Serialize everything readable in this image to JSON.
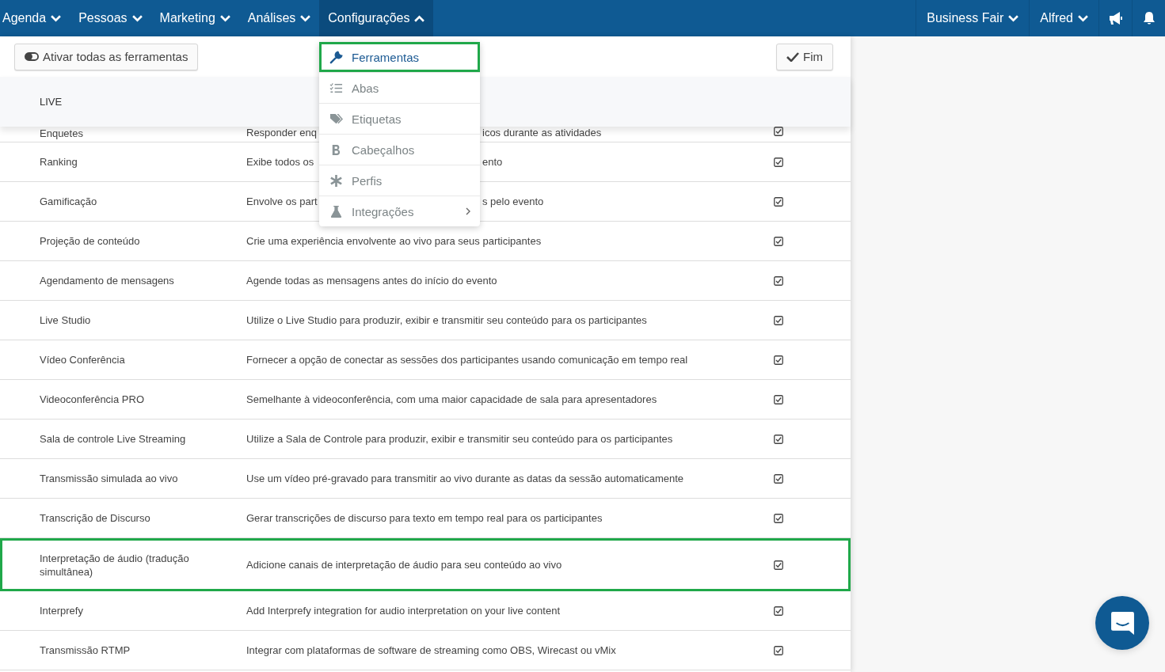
{
  "nav": {
    "items": [
      {
        "label": "Agenda",
        "expanded": false
      },
      {
        "label": "Pessoas",
        "expanded": false
      },
      {
        "label": "Marketing",
        "expanded": false
      },
      {
        "label": "Análises",
        "expanded": false
      },
      {
        "label": "Configurações",
        "expanded": true
      }
    ],
    "right": [
      {
        "label": "Business Fair",
        "expanded": false
      },
      {
        "label": "Alfred",
        "expanded": false
      }
    ]
  },
  "toolbar": {
    "toggle_button": "Ativar todas as ferramentas",
    "done_button": "Fim"
  },
  "table": {
    "section": "LIVE",
    "rows": [
      {
        "name": "Enquetes",
        "description_parts": [
          "Responder enq",
          "icos durante as atividades"
        ],
        "checked": true,
        "highlighted": false
      },
      {
        "name": "Ranking",
        "description_parts": [
          "Exibe todos os",
          "ento"
        ],
        "checked": true,
        "highlighted": false
      },
      {
        "name": "Gamificação",
        "description_parts": [
          "Envolve os part",
          "s pelo evento"
        ],
        "checked": true,
        "highlighted": false
      },
      {
        "name": "Projeção de conteúdo",
        "description": "Crie uma experiência envolvente ao vivo para seus participantes",
        "checked": true,
        "highlighted": false
      },
      {
        "name": "Agendamento de mensagens",
        "description": "Agende todas as mensagens antes do início do evento",
        "checked": true,
        "highlighted": false
      },
      {
        "name": "Live Studio",
        "description": "Utilize o Live Studio para produzir, exibir e transmitir seu conteúdo para os participantes",
        "checked": true,
        "highlighted": false
      },
      {
        "name": "Vídeo Conferência",
        "description": "Fornecer a opção de conectar as sessões dos participantes usando comunicação em tempo real",
        "checked": true,
        "highlighted": false
      },
      {
        "name": "Videoconferência PRO",
        "description": "Semelhante à videoconferência, com uma maior capacidade de sala para apresentadores",
        "checked": true,
        "highlighted": false
      },
      {
        "name": "Sala de controle Live Streaming",
        "description": "Utilize a Sala de Controle para produzir, exibir e transmitir seu conteúdo para os participantes",
        "checked": true,
        "highlighted": false
      },
      {
        "name": "Transmissão simulada ao vivo",
        "description": "Use um vídeo pré-gravado para transmitir ao vivo durante as datas da sessão automaticamente",
        "checked": true,
        "highlighted": false
      },
      {
        "name": "Transcrição de Discurso",
        "description": "Gerar transcrições de discurso para texto em tempo real para os participantes",
        "checked": true,
        "highlighted": false
      },
      {
        "name": "Interpretação de áudio (tradução simultânea)",
        "description": "Adicione canais de interpretação de áudio para seu conteúdo ao vivo",
        "checked": true,
        "highlighted": true
      },
      {
        "name": "Interprefy",
        "description": "Add Interprefy integration for audio interpretation on your live content",
        "checked": true,
        "highlighted": false
      },
      {
        "name": "Transmissão RTMP",
        "description": "Integrar com plataformas de software de streaming como OBS, Wirecast ou vMix",
        "checked": true,
        "highlighted": false
      }
    ]
  },
  "dropdown": {
    "items": [
      {
        "label": "Ferramentas",
        "kind": "wrench",
        "selected": true,
        "highlighted": true,
        "submenu": false
      },
      {
        "label": "Abas",
        "kind": "list",
        "selected": false,
        "highlighted": false,
        "submenu": false
      },
      {
        "label": "Etiquetas",
        "kind": "tags",
        "selected": false,
        "highlighted": false,
        "submenu": false
      },
      {
        "label": "Cabeçalhos",
        "kind": "bold",
        "selected": false,
        "highlighted": false,
        "submenu": false
      },
      {
        "label": "Perfis",
        "kind": "asterisk",
        "selected": false,
        "highlighted": false,
        "submenu": false
      },
      {
        "label": "Integrações",
        "kind": "flask",
        "selected": false,
        "highlighted": false,
        "submenu": true
      }
    ]
  }
}
